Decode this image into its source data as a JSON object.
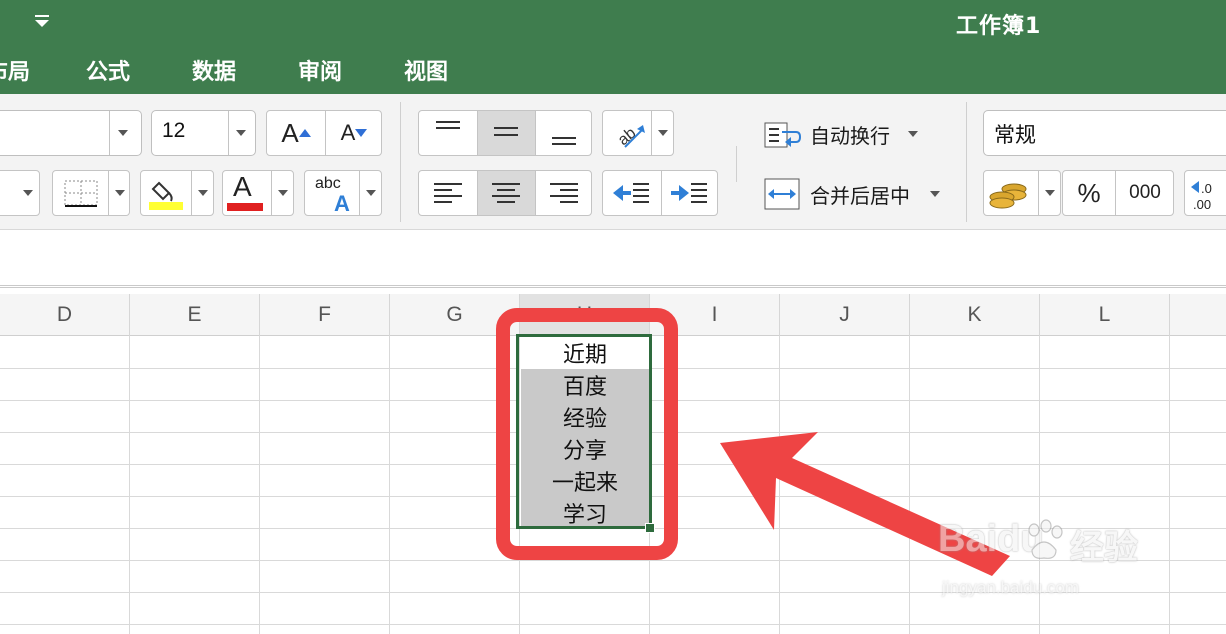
{
  "window": {
    "title": "工作簿1"
  },
  "tabs": [
    {
      "label": "布局"
    },
    {
      "label": "公式"
    },
    {
      "label": "数据"
    },
    {
      "label": "审阅"
    },
    {
      "label": "视图"
    }
  ],
  "ribbon": {
    "font_size": "12",
    "alignment": {
      "wrap_text": "自动换行",
      "merge_center": "合并后居中"
    },
    "number": {
      "format": "常规",
      "thousands": "000",
      "percent": "%"
    },
    "font": {
      "grow": "A",
      "shrink": "A",
      "color_letter": "A",
      "phonetic": "abc"
    },
    "colors": {
      "fill": "#ffff33",
      "font_color": "#e02020"
    }
  },
  "sheet": {
    "columns": [
      "D",
      "E",
      "F",
      "G",
      "H",
      "I",
      "J",
      "K",
      "L"
    ],
    "selected_column": "H",
    "cells": [
      "近期",
      "百度",
      "经验",
      "分享",
      "一起来",
      "学习"
    ]
  },
  "annotation": {
    "color": "#ee4444"
  },
  "watermark": {
    "brand": "Baidu",
    "suffix": "经验",
    "url": "jingyan.baidu.com"
  }
}
